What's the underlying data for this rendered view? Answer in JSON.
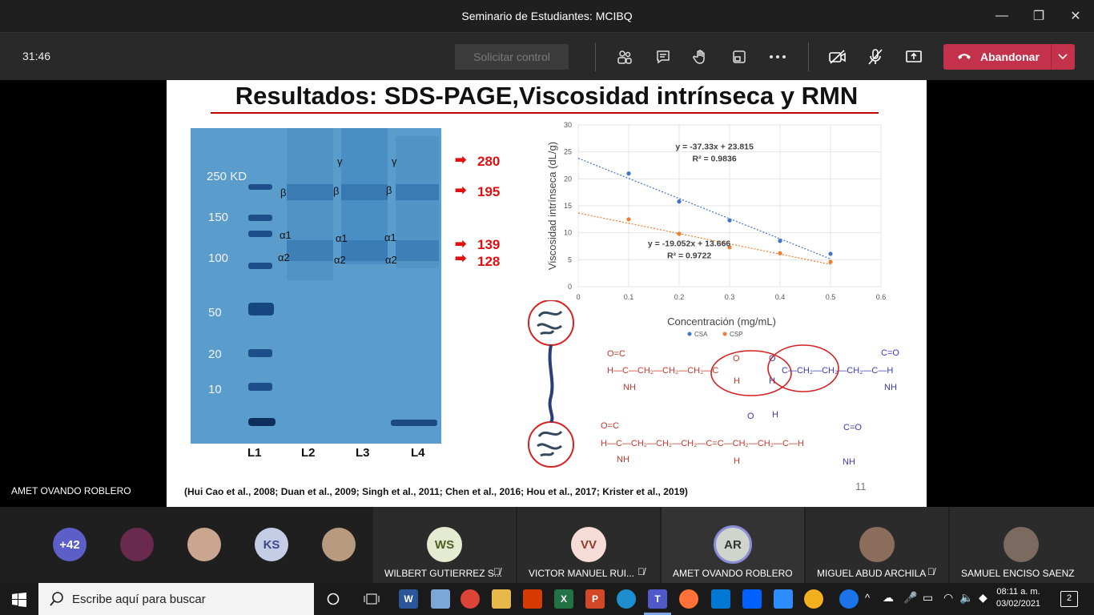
{
  "window": {
    "title": "Seminario de Estudiantes: MCIBQ",
    "controls": [
      "—",
      "❐",
      "✕"
    ]
  },
  "toolbar": {
    "timer": "31:46",
    "request_control": "Solicitar control",
    "leave": "Abandonar"
  },
  "slide": {
    "title": "Resultados: SDS-PAGE,Viscosidad intrínseca y RMN",
    "gel": {
      "mw_labels": [
        "250 KD",
        "150",
        "100",
        "50",
        "20",
        "10"
      ],
      "lane_labels": [
        "L1",
        "L2",
        "L3",
        "L4"
      ],
      "subunits": {
        "beta": "β",
        "alpha1": "α1",
        "alpha2": "α2",
        "gamma": "γ"
      },
      "arrow": "➡",
      "arrow_values": [
        "280",
        "195",
        "139",
        "128"
      ]
    },
    "chart_title_sub": "Concentración (mg/mL)",
    "struct_labels": {
      "c": "C",
      "o": "O",
      "h": "H",
      "nh": "NH",
      "ch2": "CH₂",
      "eq": "=",
      "dash": "—"
    },
    "references": "(Hui Cao et al., 2008; Duan et al., 2009; Singh et al., 2011; Chen et al., 2016; Hou et al., 2017; Krister et al., 2019)",
    "page_number": "11"
  },
  "chart_data": {
    "type": "scatter",
    "xlabel": "Concentración (mg/mL)",
    "ylabel": "Viscosidad intrínseca (dL/g)",
    "xlim": [
      0,
      0.6
    ],
    "ylim": [
      0,
      30
    ],
    "xticks": [
      "0",
      "0.1",
      "0.2",
      "0.3",
      "0.4",
      "0.5",
      "0.6"
    ],
    "yticks": [
      "0",
      "5",
      "10",
      "15",
      "20",
      "25",
      "30"
    ],
    "grid": true,
    "legend_position": "bottom",
    "series": [
      {
        "name": "CSA",
        "color": "#4472c4",
        "x": [
          0.1,
          0.2,
          0.3,
          0.4,
          0.5
        ],
        "y": [
          21,
          15.8,
          12.3,
          8.5,
          6.1
        ],
        "equation": "y = -37.33x + 23.815",
        "r2": "R² = 0.9836"
      },
      {
        "name": "CSP",
        "color": "#ed7d31",
        "x": [
          0.1,
          0.2,
          0.3,
          0.4,
          0.5
        ],
        "y": [
          12.5,
          9.8,
          7.3,
          6.2,
          4.6
        ],
        "equation": "y = -19.052x + 13.666",
        "r2": "R² = 0.9722"
      }
    ]
  },
  "speaker": "AMET OVANDO ROBLERO",
  "participants": {
    "overflow": "+42",
    "small": [
      {
        "initials": ""
      },
      {
        "initials": ""
      },
      {
        "initials": "KS"
      },
      {
        "initials": ""
      }
    ],
    "tiles": [
      {
        "initials": "WS",
        "name": "WILBERT GUTIERREZ S..."
      },
      {
        "initials": "VV",
        "name": "VICTOR MANUEL RUI..."
      },
      {
        "initials": "AR",
        "name": "AMET OVANDO ROBLERO"
      },
      {
        "initials": "",
        "name": "MIGUEL ABUD ARCHILA"
      },
      {
        "initials": "",
        "name": "SAMUEL ENCISO SAENZ"
      }
    ]
  },
  "taskbar": {
    "search_placeholder": "Escribe aquí para buscar",
    "time": "08:11 a. m.",
    "date": "03/02/2021",
    "notifications": "2",
    "apps": [
      "W",
      "",
      "",
      "",
      "",
      "X",
      "P",
      "",
      "T",
      "",
      "",
      "",
      "",
      "",
      ""
    ]
  }
}
